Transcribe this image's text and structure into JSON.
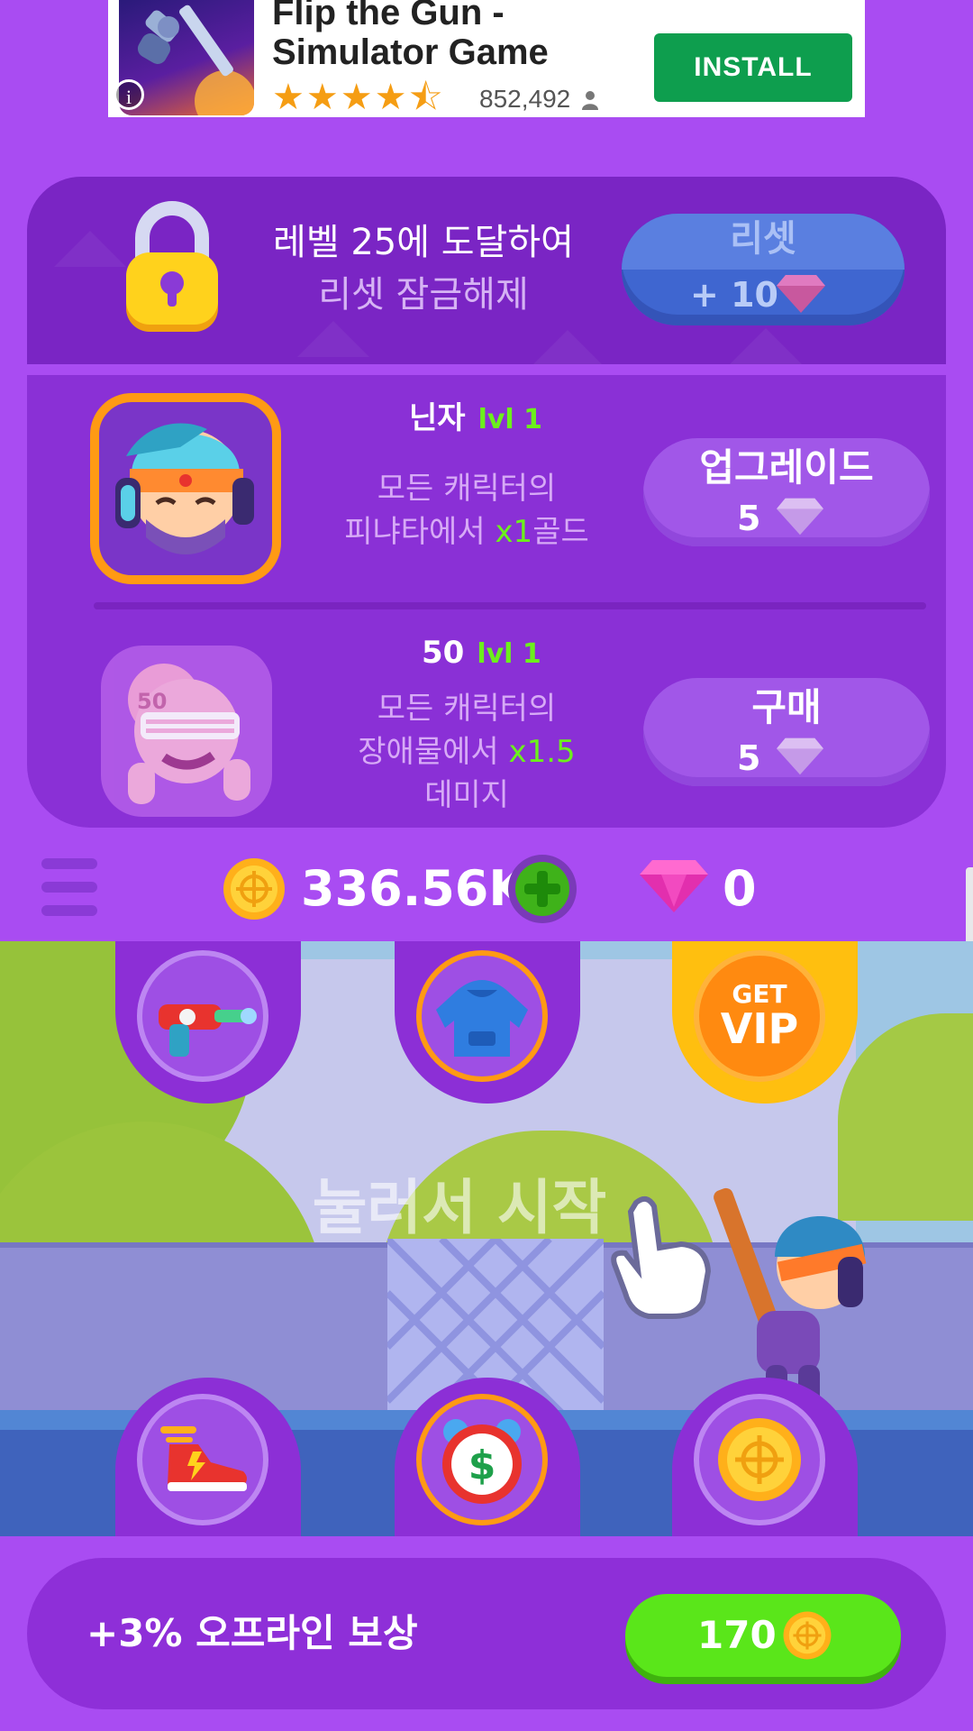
{
  "ad": {
    "title": "Flip the Gun - Simulator Game",
    "rating_stars": "★★★★⯪",
    "rating_count": "852,492",
    "install_label": "INSTALL",
    "info_label": "i"
  },
  "reset_panel": {
    "unlock_line1": "레벨 25에 도달하여",
    "unlock_line2": "리셋 잠금해제",
    "reset_label": "리셋",
    "reset_reward": "+ 10"
  },
  "characters": [
    {
      "name": "닌자",
      "level": "lvl 1",
      "desc_line1": "모든 캐릭터의",
      "desc_pre": "피냐타에서 ",
      "desc_highlight": "x1",
      "desc_post": "골드",
      "desc_line3": "",
      "button_label": "업그레이드",
      "button_cost": "5"
    },
    {
      "name": "50",
      "level": "lvl 1",
      "desc_line1": "모든 캐릭터의",
      "desc_pre": "장애물에서 ",
      "desc_highlight": "x1.5",
      "desc_post": "",
      "desc_line3": "데미지",
      "button_label": "구매",
      "button_cost": "5",
      "portrait_badge": "50"
    }
  ],
  "currency": {
    "coins": "336.56K",
    "gems": "0"
  },
  "scene": {
    "start_text": "눌러서 시작",
    "vip_line1": "GET",
    "vip_line2": "VIP"
  },
  "offline_reward": {
    "label": "+3% 오프라인 보상",
    "amount": "170"
  },
  "colors": {
    "background": "#a94cf2",
    "panel": "#8a30d6",
    "level_green": "#6cf01c",
    "coin_gold": "#ffc21a",
    "gem_pink": "#f23ec4",
    "install_green": "#0e9e4e"
  }
}
